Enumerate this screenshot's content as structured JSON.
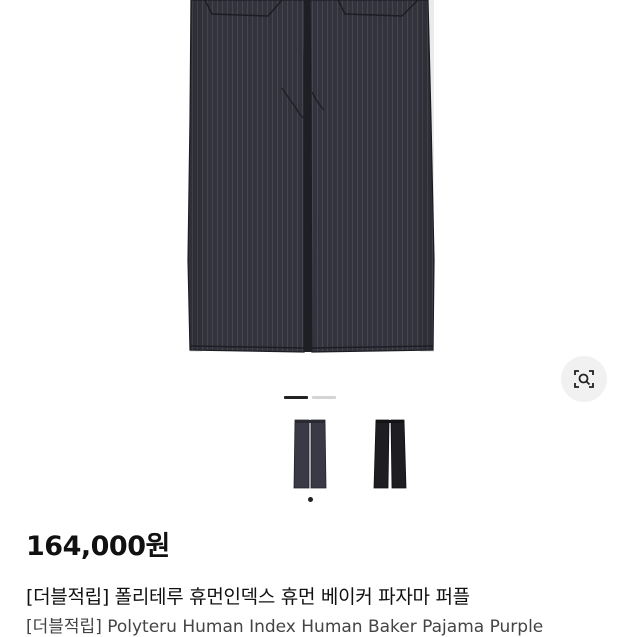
{
  "product": {
    "price": "164,000원",
    "title": "[더블적립] 폴리테루 휴먼인덱스 휴먼 베이커 파자마 퍼플",
    "subtitle": "[더블적립] Polyteru Human Index Human Baker Pajama Purple"
  },
  "gallery": {
    "current_index": 1,
    "total": 2,
    "thumbnails": [
      "navy-pinstripe-pants",
      "black-pants"
    ],
    "lens_button_icon": "image-search-icon"
  },
  "colors": {
    "pants_main": "#34343e",
    "pants_dark": "#22222a",
    "indicator_active": "#222222",
    "indicator_inactive": "#d4d4d4"
  }
}
